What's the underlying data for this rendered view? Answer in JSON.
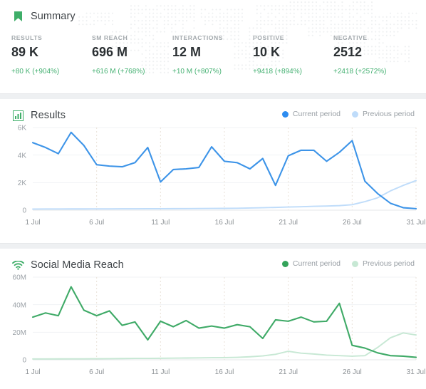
{
  "summary": {
    "icon": "bookmark-icon",
    "title": "Summary",
    "metrics": [
      {
        "label": "RESULTS",
        "value": "89 K",
        "delta": "+80 K (+904%)"
      },
      {
        "label": "SM REACH",
        "value": "696 M",
        "delta": "+616 M (+768%)"
      },
      {
        "label": "INTERACTIONS",
        "value": "12 M",
        "delta": "+10 M (+807%)"
      },
      {
        "label": "POSITIVE",
        "value": "10 K",
        "delta": "+9418 (+894%)"
      },
      {
        "label": "NEGATIVE",
        "value": "2512",
        "delta": "+2418 (+2572%)"
      }
    ]
  },
  "results_card": {
    "icon": "bar-chart-icon",
    "title": "Results",
    "legend": [
      {
        "label": "Current period",
        "color": "#2d8cf0"
      },
      {
        "label": "Previous period",
        "color": "#bfdcfa"
      }
    ]
  },
  "reach_card": {
    "icon": "wifi-icon",
    "title": "Social Media Reach",
    "legend": [
      {
        "label": "Current period",
        "color": "#34a35a"
      },
      {
        "label": "Previous period",
        "color": "#c7e8d4"
      }
    ]
  },
  "colors": {
    "accent_green": "#46b173",
    "accent_blue": "#2d8cf0",
    "text_dark": "#2b3033",
    "text_muted": "#9aa0a6",
    "card_bg": "#ffffff",
    "page_bg": "#eef0f2"
  },
  "chart_data": [
    {
      "type": "line",
      "title": "Results",
      "xlabel": "",
      "ylabel": "",
      "grid": true,
      "legend_position": "top-right",
      "ylim": [
        0,
        6000
      ],
      "yticks": [
        0,
        2000,
        4000,
        6000
      ],
      "yticklabels": [
        "0",
        "2K",
        "4K",
        "6K"
      ],
      "x": [
        "1 Jul",
        "2 Jul",
        "3 Jul",
        "4 Jul",
        "5 Jul",
        "6 Jul",
        "7 Jul",
        "8 Jul",
        "9 Jul",
        "10 Jul",
        "11 Jul",
        "12 Jul",
        "13 Jul",
        "14 Jul",
        "15 Jul",
        "16 Jul",
        "17 Jul",
        "18 Jul",
        "19 Jul",
        "20 Jul",
        "21 Jul",
        "22 Jul",
        "23 Jul",
        "24 Jul",
        "25 Jul",
        "26 Jul",
        "27 Jul",
        "28 Jul",
        "29 Jul",
        "30 Jul",
        "31 Jul"
      ],
      "xticklabels": [
        "1 Jul",
        "6 Jul",
        "11 Jul",
        "16 Jul",
        "21 Jul",
        "26 Jul",
        "31 Jul"
      ],
      "series": [
        {
          "name": "Current period",
          "color": "#3d94e8",
          "values": [
            4900,
            4550,
            4100,
            5650,
            4700,
            3300,
            3200,
            3150,
            3450,
            4550,
            2050,
            2950,
            3000,
            3100,
            4600,
            3550,
            3450,
            3000,
            3750,
            1800,
            3950,
            4350,
            4350,
            3550,
            4200,
            5050,
            2100,
            1200,
            500,
            180,
            110
          ]
        },
        {
          "name": "Previous period",
          "color": "#bfdcfa",
          "values": [
            80,
            85,
            85,
            90,
            90,
            95,
            95,
            100,
            100,
            105,
            105,
            110,
            115,
            120,
            125,
            130,
            140,
            160,
            180,
            200,
            230,
            250,
            280,
            300,
            330,
            400,
            620,
            900,
            1400,
            1800,
            2150
          ]
        }
      ]
    },
    {
      "type": "line",
      "title": "Social Media Reach",
      "xlabel": "",
      "ylabel": "",
      "grid": true,
      "legend_position": "top-right",
      "ylim": [
        0,
        60000000
      ],
      "yticks": [
        0,
        20000000,
        40000000,
        60000000
      ],
      "yticklabels": [
        "0",
        "20M",
        "40M",
        "60M"
      ],
      "x": [
        "1 Jul",
        "2 Jul",
        "3 Jul",
        "4 Jul",
        "5 Jul",
        "6 Jul",
        "7 Jul",
        "8 Jul",
        "9 Jul",
        "10 Jul",
        "11 Jul",
        "12 Jul",
        "13 Jul",
        "14 Jul",
        "15 Jul",
        "16 Jul",
        "17 Jul",
        "18 Jul",
        "19 Jul",
        "20 Jul",
        "21 Jul",
        "22 Jul",
        "23 Jul",
        "24 Jul",
        "25 Jul",
        "26 Jul",
        "27 Jul",
        "28 Jul",
        "29 Jul",
        "30 Jul",
        "31 Jul"
      ],
      "xticklabels": [
        "1 Jul",
        "6 Jul",
        "11 Jul",
        "16 Jul",
        "21 Jul",
        "26 Jul",
        "31 Jul"
      ],
      "series": [
        {
          "name": "Current period",
          "color": "#3faa67",
          "values": [
            31000000,
            34000000,
            32000000,
            53000000,
            36000000,
            32000000,
            35500000,
            25000000,
            27500000,
            14500000,
            28000000,
            24000000,
            28500000,
            23000000,
            24500000,
            23000000,
            25500000,
            24000000,
            15500000,
            29000000,
            28000000,
            31000000,
            27500000,
            28000000,
            41000000,
            10500000,
            8500000,
            5000000,
            3000000,
            2600000,
            1800000
          ]
        },
        {
          "name": "Previous period",
          "color": "#c7e8d4",
          "values": [
            600000,
            600000,
            650000,
            700000,
            700000,
            750000,
            800000,
            900000,
            1000000,
            1000000,
            1100000,
            1200000,
            1300000,
            1400000,
            1500000,
            1600000,
            1800000,
            2200000,
            2800000,
            4000000,
            6200000,
            4800000,
            4200000,
            3400000,
            3000000,
            2600000,
            3000000,
            9000000,
            16000000,
            19500000,
            18000000
          ]
        }
      ]
    }
  ]
}
